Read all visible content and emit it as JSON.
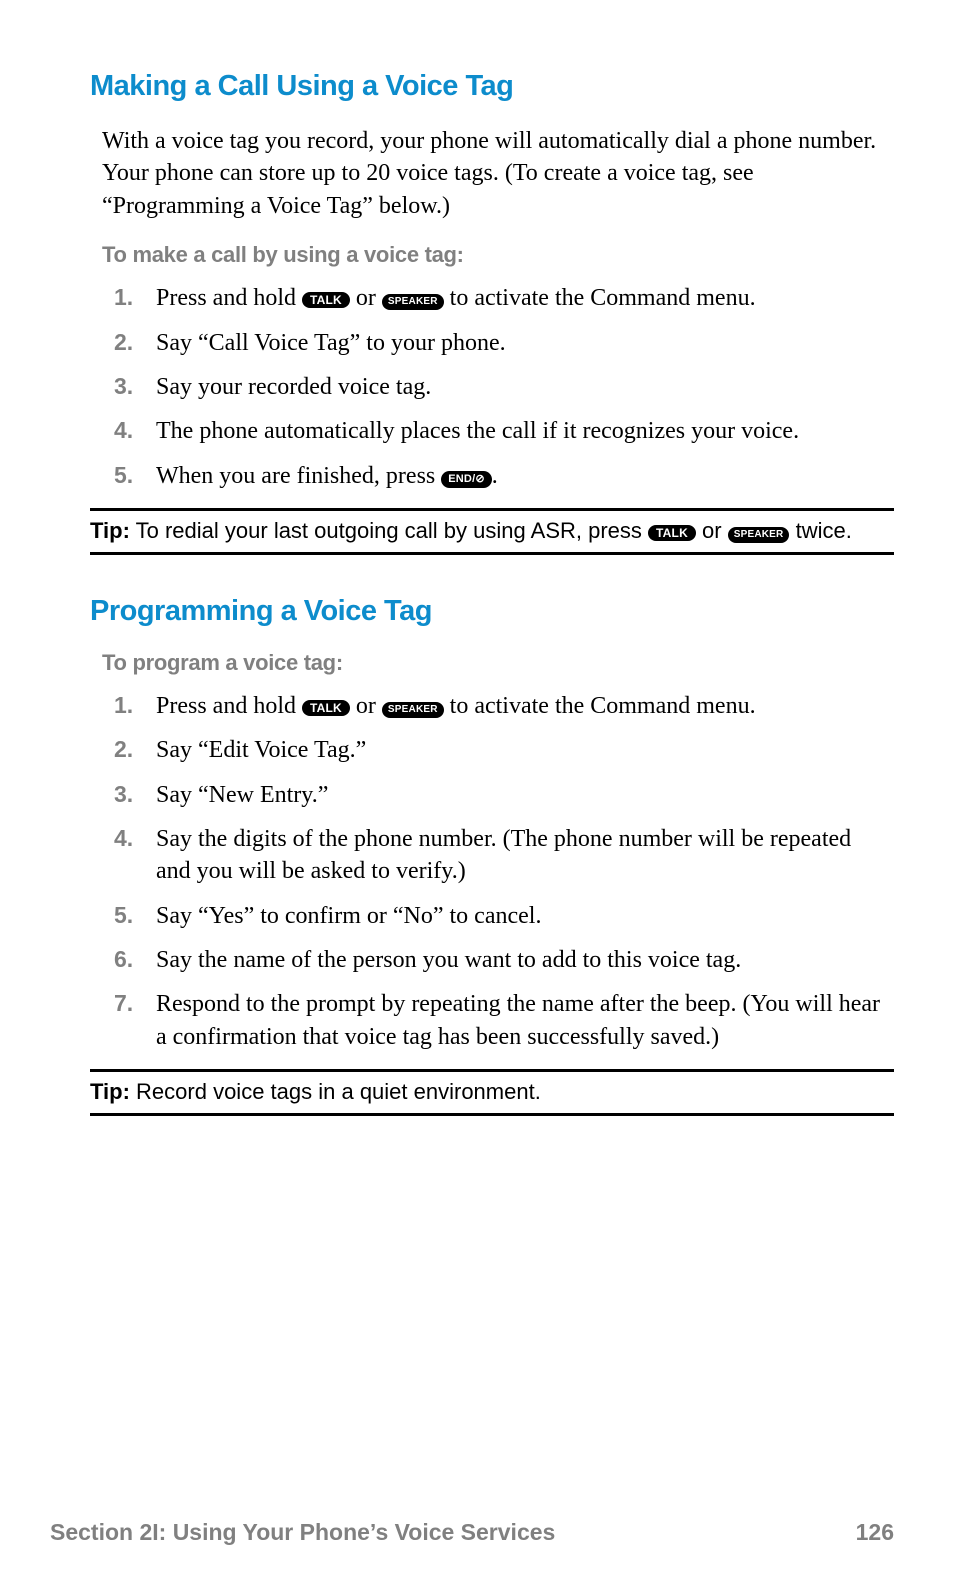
{
  "section1": {
    "heading": "Making a Call Using a Voice Tag",
    "intro": "With a voice tag you record, your phone will automatically dial a phone number. Your phone can store up to 20 voice tags. (To create a voice tag, see “Programming a Voice Tag” below.)",
    "subhead": "To make a call by using a voice tag:",
    "steps": {
      "s1a": "Press and hold ",
      "s1b": " or ",
      "s1c": " to activate the Command menu.",
      "s2": "Say “Call Voice Tag” to your phone.",
      "s3": "Say your recorded voice tag.",
      "s4": "The phone automatically places the call if it recognizes your voice.",
      "s5a": "When you are finished, press ",
      "s5b": "."
    },
    "tip": {
      "label": "Tip:",
      "a": " To redial your last outgoing call by using ASR, press ",
      "b": " or ",
      "c": " twice."
    }
  },
  "section2": {
    "heading": "Programming a Voice Tag",
    "subhead": "To program a voice tag:",
    "steps": {
      "s1a": "Press and hold ",
      "s1b": " or ",
      "s1c": " to activate the Command menu.",
      "s2": "Say “Edit Voice Tag.”",
      "s3": "Say “New Entry.”",
      "s4": "Say the digits of the phone number. (The phone number will be repeated and you will be asked to verify.)",
      "s5": "Say “Yes” to confirm or “No” to cancel.",
      "s6": "Say the name of the person you want to add to this voice tag.",
      "s7": "Respond to the prompt by repeating the name after the beep. (You will hear a confirmation that voice tag has been successfully saved.)"
    },
    "tip": {
      "label": "Tip:",
      "text": " Record voice tags in a quiet environment."
    }
  },
  "keys": {
    "talk": "TALK",
    "speaker": "SPEAKER",
    "end": "END/⊘"
  },
  "footer": {
    "left": "Section 2I: Using Your Phone’s Voice Services",
    "right": "126"
  }
}
